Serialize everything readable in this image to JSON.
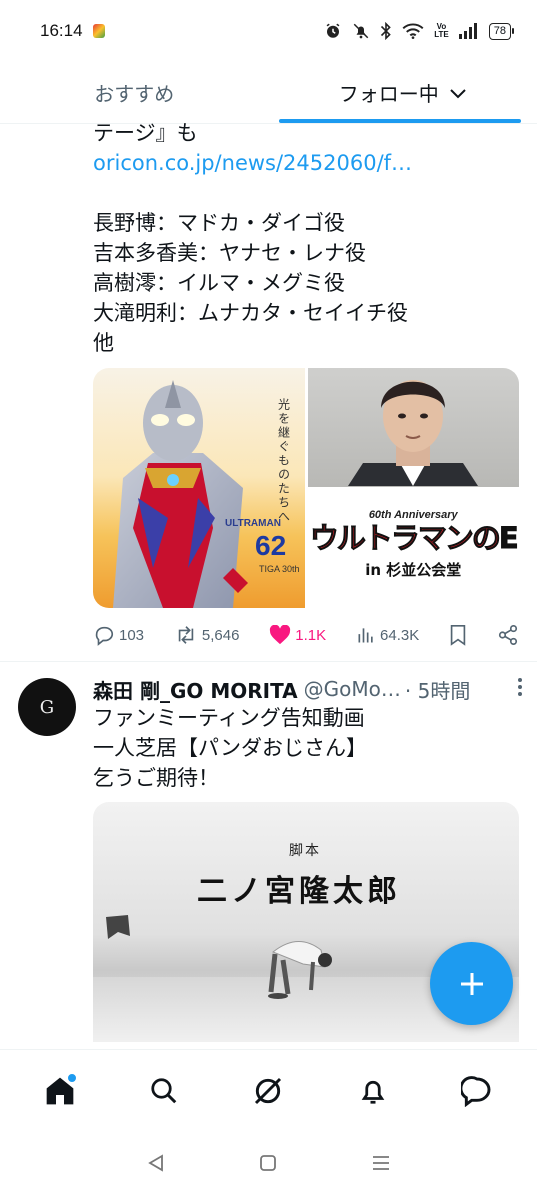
{
  "status_bar": {
    "time": "16:14",
    "battery": "78",
    "volte_top": "Vo",
    "volte_bottom": "LTE",
    "icons": [
      "app-notification-icon",
      "alarm-icon",
      "mute-icon",
      "bluetooth-icon",
      "wifi-icon",
      "volte-icon",
      "signal-icon",
      "battery-icon"
    ]
  },
  "tabs": {
    "recommended": "おすすめ",
    "following": "フォロー中"
  },
  "tweet1": {
    "text_lines": [
      "テージ』も",
      "oricon.co.jp/news/2452060/f…",
      "",
      "長野博：マドカ・ダイゴ役",
      "吉本多香美：ヤナセ・レナ役",
      "高樹澪：イルマ・メグミ役",
      "大滝明利：ムナカタ・セイイチ役",
      "他"
    ],
    "link": "oricon.co.jp/news/2452060/f…",
    "media": {
      "vertical_text": "光を継ぐものたちへ",
      "ultra_label": "ULTRAMAN",
      "ultra_number": "62",
      "ultra_sub": "TIGA 30th",
      "anniversary": "60th Anniversary",
      "logo_title_main": "ウルトラマンの",
      "logo_title_tail": "E",
      "venue": "in 杉並公会堂"
    },
    "actions": {
      "replies": "103",
      "reposts": "5,646",
      "likes": "1.1K",
      "views": "64.3K"
    }
  },
  "tweet2": {
    "avatar_letter": "G",
    "display_name": "森田 剛_GO MORITA",
    "handle": "@GoMo…",
    "time": "· 5時間",
    "text_lines": [
      "ファンミーティング告知動画",
      "一人芝居【パンダおじさん】",
      "乞うご期待！"
    ],
    "media": {
      "credit_label": "脚本",
      "credit_name": "二ノ宮隆太郎"
    }
  },
  "fab": {
    "icon": "plus-icon"
  },
  "bottom_nav": [
    "home-icon",
    "search-icon",
    "grok-icon",
    "notifications-icon",
    "messages-icon"
  ],
  "system_nav": [
    "back-icon",
    "home-button-icon",
    "recents-icon"
  ],
  "colors": {
    "accent": "#1d9bf0",
    "like": "#f91880",
    "text": "#0f1419",
    "secondary": "#536471"
  }
}
